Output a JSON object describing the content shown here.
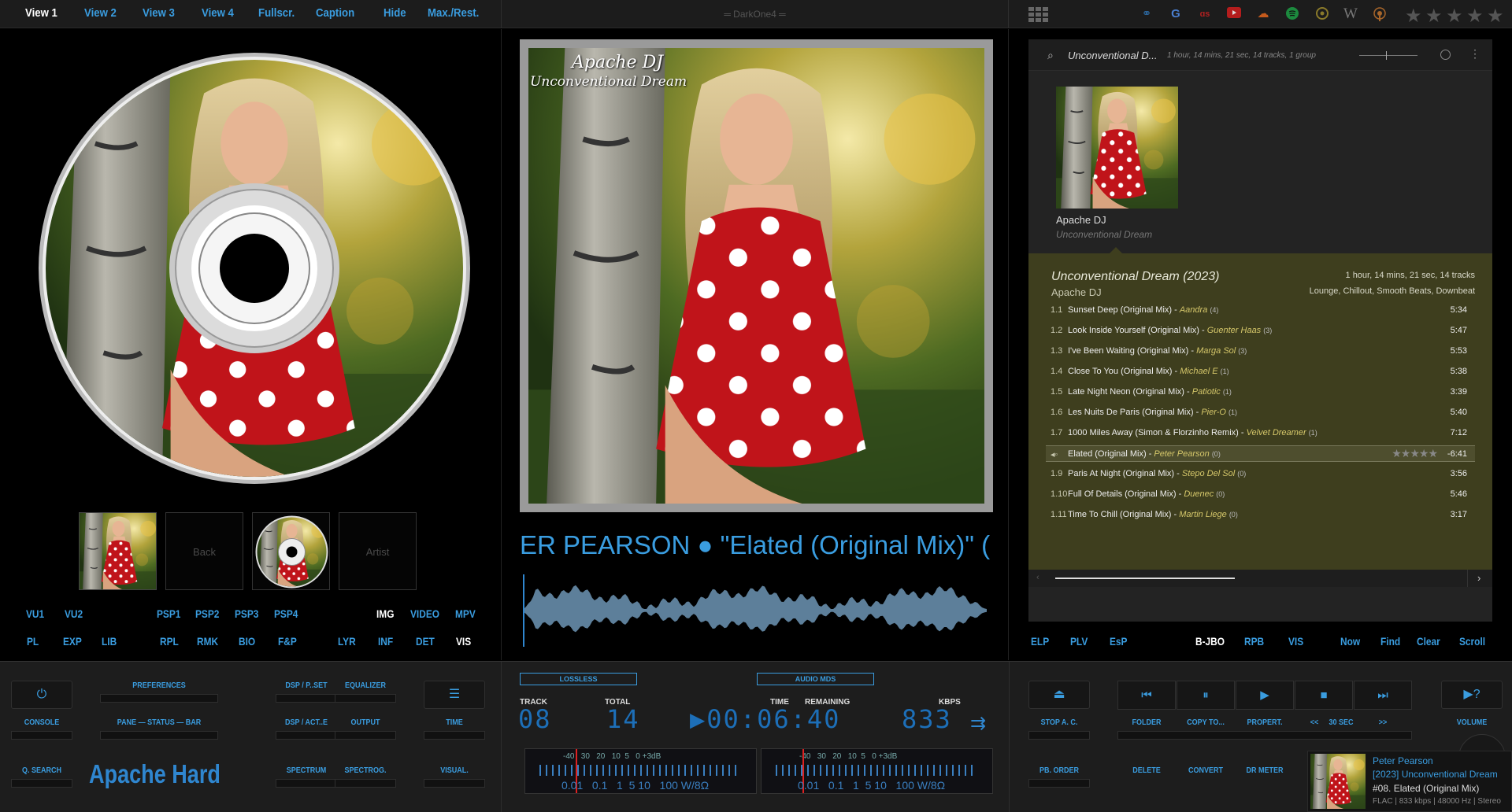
{
  "app": {
    "skin_title": "═ DarkOne4 ═"
  },
  "topbar": {
    "view_buttons": [
      "View 1",
      "View 2",
      "View 3",
      "View 4",
      "Fullscr.",
      "Caption",
      "Hide",
      "Max./Rest."
    ],
    "stars": [
      "★",
      "★",
      "★",
      "★",
      "★"
    ]
  },
  "cover_text": {
    "artist": "Apache DJ",
    "album": "Unconventional Dream"
  },
  "left_panel": {
    "thumbs": [
      "",
      "Back",
      "",
      "Artist"
    ],
    "row1": [
      "VU1",
      "VU2",
      "PSP1",
      "PSP2",
      "PSP3",
      "PSP4",
      "IMG",
      "VIDEO",
      "MPV"
    ],
    "row2": [
      "PL",
      "EXP",
      "LIB",
      "RPL",
      "RMK",
      "BIO",
      "F&P",
      "LYR",
      "INF",
      "DET",
      "VIS"
    ]
  },
  "center_panel": {
    "scroll_text": "ER PEARSON ● \"Elated (Original Mix)\" ("
  },
  "playlist": {
    "search_title": "Unconventional D...",
    "meta": "1 hour, 14 mins, 21 sec,  14 tracks,  1 group",
    "album_artist": "Apache DJ",
    "album_name": "Unconventional Dream",
    "group": {
      "title": "Unconventional Dream (2023)",
      "artist": "Apache DJ",
      "duration": "1 hour, 14 mins, 21 sec,  14 tracks",
      "genres": "Lounge, Chillout, Smooth Beats, Downbeat"
    },
    "tracks": [
      {
        "num": "1.1",
        "title": "Sunset Deep (Original Mix)",
        "artist": "Aandra",
        "count": "(4)",
        "dur": "5:34"
      },
      {
        "num": "1.2",
        "title": "Look Inside Yourself (Original Mix)",
        "artist": "Guenter Haas",
        "count": "(3)",
        "dur": "5:47"
      },
      {
        "num": "1.3",
        "title": "I've Been Waiting (Original Mix)",
        "artist": "Marga Sol",
        "count": "(3)",
        "dur": "5:53"
      },
      {
        "num": "1.4",
        "title": "Close To You (Original Mix)",
        "artist": "Michael E",
        "count": "(1)",
        "dur": "5:38"
      },
      {
        "num": "1.5",
        "title": "Late Night Neon (Original Mix)",
        "artist": "Patiotic",
        "count": "(1)",
        "dur": "3:39"
      },
      {
        "num": "1.6",
        "title": "Les Nuits De Paris (Original Mix)",
        "artist": "Pier-O",
        "count": "(1)",
        "dur": "5:40"
      },
      {
        "num": "1.7",
        "title": "1000 Miles Away (Simon & Florzinho Remix)",
        "artist": "Velvet Dreamer",
        "count": "(1)",
        "dur": "7:12"
      },
      {
        "num": "◂◦",
        "title": "Elated (Original Mix)",
        "artist": "Peter Pearson",
        "count": "(0)",
        "dur": "-6:41",
        "playing": true
      },
      {
        "num": "1.9",
        "title": "Paris At Night (Original Mix)",
        "artist": "Stepo Del Sol",
        "count": "(0)",
        "dur": "3:56"
      },
      {
        "num": "1.10",
        "title": "Full Of Details (Original Mix)",
        "artist": "Duenec",
        "count": "(0)",
        "dur": "5:46"
      },
      {
        "num": "1.11",
        "title": "Time To Chill (Original Mix)",
        "artist": "Martin Liege",
        "count": "(0)",
        "dur": "3:17"
      }
    ],
    "playing_stars": "★★★★★"
  },
  "right_panel_buttons": {
    "left": [
      "ELP",
      "PLV",
      "EsP"
    ],
    "right": [
      "B-JBO",
      "RPB",
      "VIS",
      "Now",
      "Find",
      "Clear",
      "Scroll"
    ]
  },
  "controls_left": {
    "console": "CONSOLE",
    "search": "Q. SEARCH",
    "preferences": "PREFERENCES",
    "pane_status_bar": "PANE — STATUS — BAR",
    "skin_name": "Apache Hard",
    "dsp_pset": "DSP / P..SET",
    "equalizer": "EQUALIZER",
    "dsp_act": "DSP / ACT..E",
    "output": "OUTPUT",
    "spectrum": "SPECTRUM",
    "spectrog": "SPECTROG.",
    "time": "TIME",
    "visual": "VISUAL."
  },
  "lcd": {
    "lossless": "LOSSLESS",
    "audio_mode": "AUDIO MDS",
    "track_lbl": "TRACK",
    "total_lbl": "TOTAL",
    "time_lbl": "TIME",
    "remaining_lbl": "REMAINING",
    "kbps_lbl": "KBPS",
    "track": "08",
    "total": "14",
    "time": "▶00:06:40",
    "kbps": "833",
    "meter_top": "-40   30   20   10  5   0 +3dB",
    "meter_bottom": "0.01   0.1   1  5 10   100 W/8Ω",
    "meter_top_2": "-40   30   20   10  5   0 +3dB",
    "meter_bottom_2": "0.01   0.1   1  5 10   100 W/8Ω"
  },
  "controls_right": {
    "stop_ac": "STOP A. C.",
    "pb_order": "PB. ORDER",
    "folder": "FOLDER",
    "copy_to": "COPY TO...",
    "propert": "PROPERT.",
    "seek_back": "<<",
    "seek_30": "30 SEC",
    "seek_fwd": ">>",
    "volume": "VOLUME",
    "delete": "DELETE",
    "convert": "CONVERT",
    "dr_meter": "DR METER"
  },
  "now_playing": {
    "artist": "Peter Pearson",
    "album": "[2023] Unconventional Dream",
    "track": "#08. Elated (Original Mix)",
    "info": "FLAC | 833 kbps | 48000 Hz | Stereo"
  },
  "colors": {
    "accent": "#3a9de0",
    "group_bg": "#3e3e1e",
    "lcd": "#1d6fb8"
  }
}
